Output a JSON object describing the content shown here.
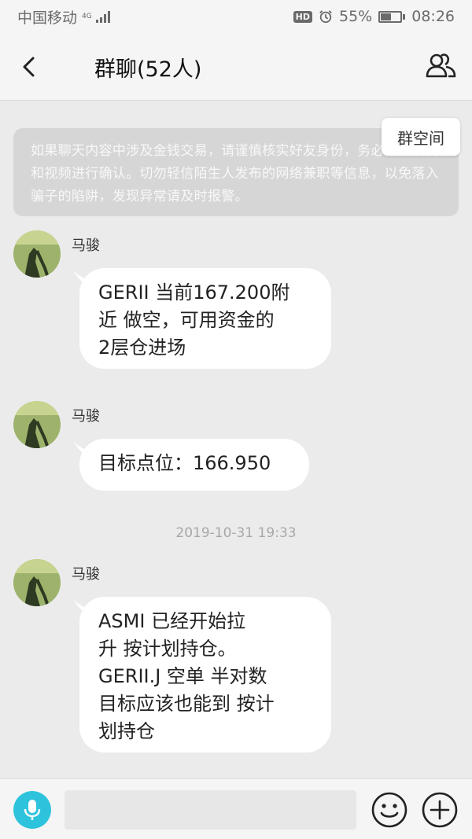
{
  "status_bar": {
    "carrier": "中国移动",
    "network": "4G",
    "hd_badge": "HD",
    "battery_percent": "55%",
    "battery_level": 0.55,
    "time": "08:26"
  },
  "header": {
    "title": "群聊(52人)"
  },
  "notice": {
    "text": "如果聊天内容中涉及金钱交易，请谨慎核实好友身份，务必通过语音和视频进行确认。切勿轻信陌生人发布的网络兼职等信息，以免落入骗子的陷阱，发现异常请及时报警。"
  },
  "group_space_button": {
    "label": "群空间"
  },
  "messages": [
    {
      "sender": "马骏",
      "lines": [
        "GERII  当前167.200附",
        "近 做空，可用资金的",
        "2层仓进场"
      ]
    },
    {
      "sender": "马骏",
      "lines": [
        "目标点位：166.950"
      ]
    },
    {
      "sender": "马骏",
      "lines": [
        "ASMI  已经开始拉",
        "升 按计划持仓。",
        "GERII.J 空单 半对数",
        "目标应该也能到 按计",
        "划持仓"
      ]
    }
  ],
  "timestamp": "2019-10-31 19:33",
  "input_bar": {
    "placeholder": ""
  },
  "icons": {
    "back": "chevron-left-icon",
    "members": "group-members-icon",
    "voice": "microphone-icon",
    "emoji": "emoji-icon",
    "plus": "plus-icon"
  },
  "colors": {
    "accent": "#2ec3dc",
    "background": "#ebebeb",
    "notice_bg": "#d6d6d6",
    "bubble": "#ffffff"
  }
}
